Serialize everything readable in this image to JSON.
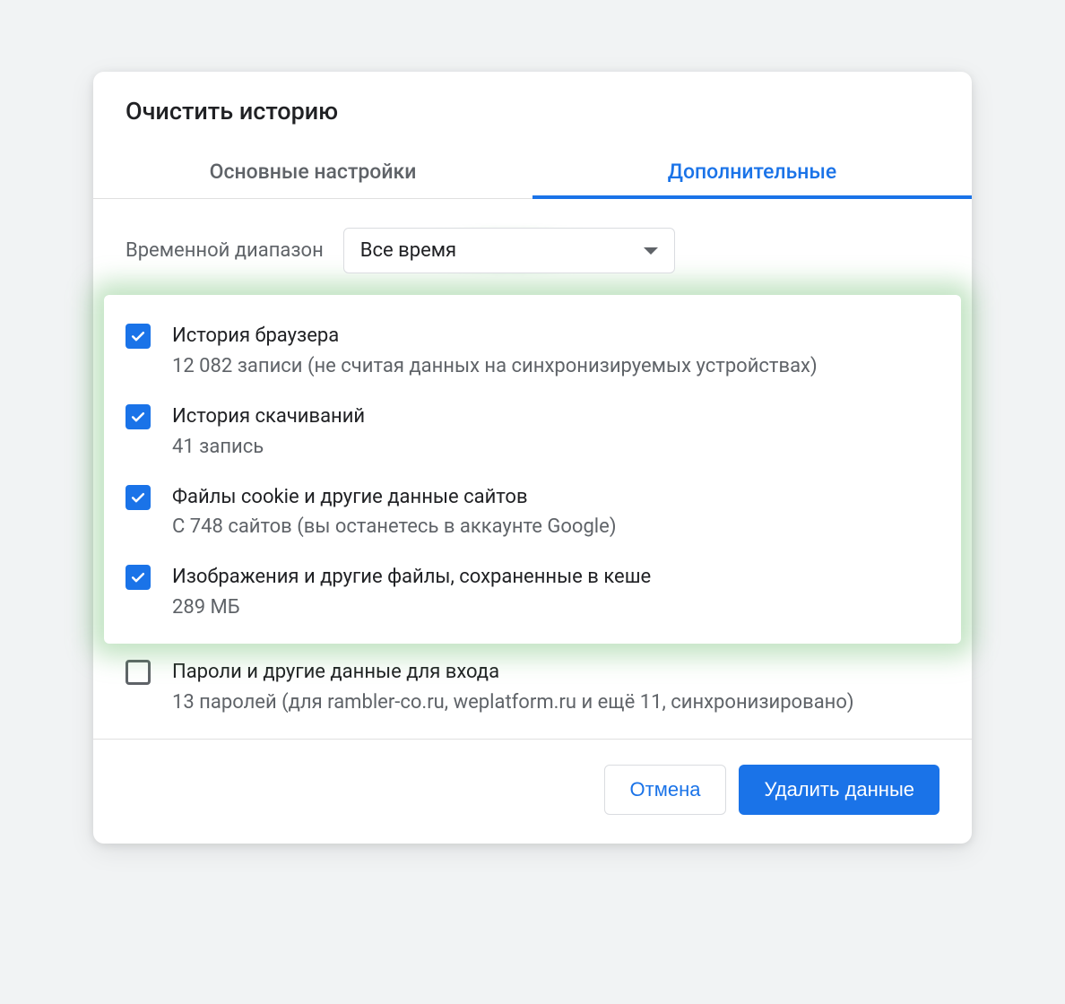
{
  "dialog": {
    "title": "Очистить историю"
  },
  "tabs": {
    "basic": "Основные настройки",
    "advanced": "Дополнительные",
    "active": "advanced"
  },
  "time_range": {
    "label": "Временной диапазон",
    "selected": "Все время"
  },
  "items": [
    {
      "title": "История браузера",
      "desc": "12 082 записи (не считая данных на синхронизируемых устройствах)",
      "checked": true,
      "highlighted": true
    },
    {
      "title": "История скачиваний",
      "desc": "41 запись",
      "checked": true,
      "highlighted": true
    },
    {
      "title": "Файлы cookie и другие данные сайтов",
      "desc": "С 748 сайтов (вы останетесь в аккаунте Google)",
      "checked": true,
      "highlighted": true
    },
    {
      "title": "Изображения и другие файлы, сохраненные в кеше",
      "desc": "289 МБ",
      "checked": true,
      "highlighted": true
    },
    {
      "title": "Пароли и другие данные для входа",
      "desc": "13 паролей (для rambler-co.ru, weplatform.ru и ещё 11, синхронизировано)",
      "checked": false,
      "highlighted": false
    }
  ],
  "buttons": {
    "cancel": "Отмена",
    "confirm": "Удалить данные"
  }
}
